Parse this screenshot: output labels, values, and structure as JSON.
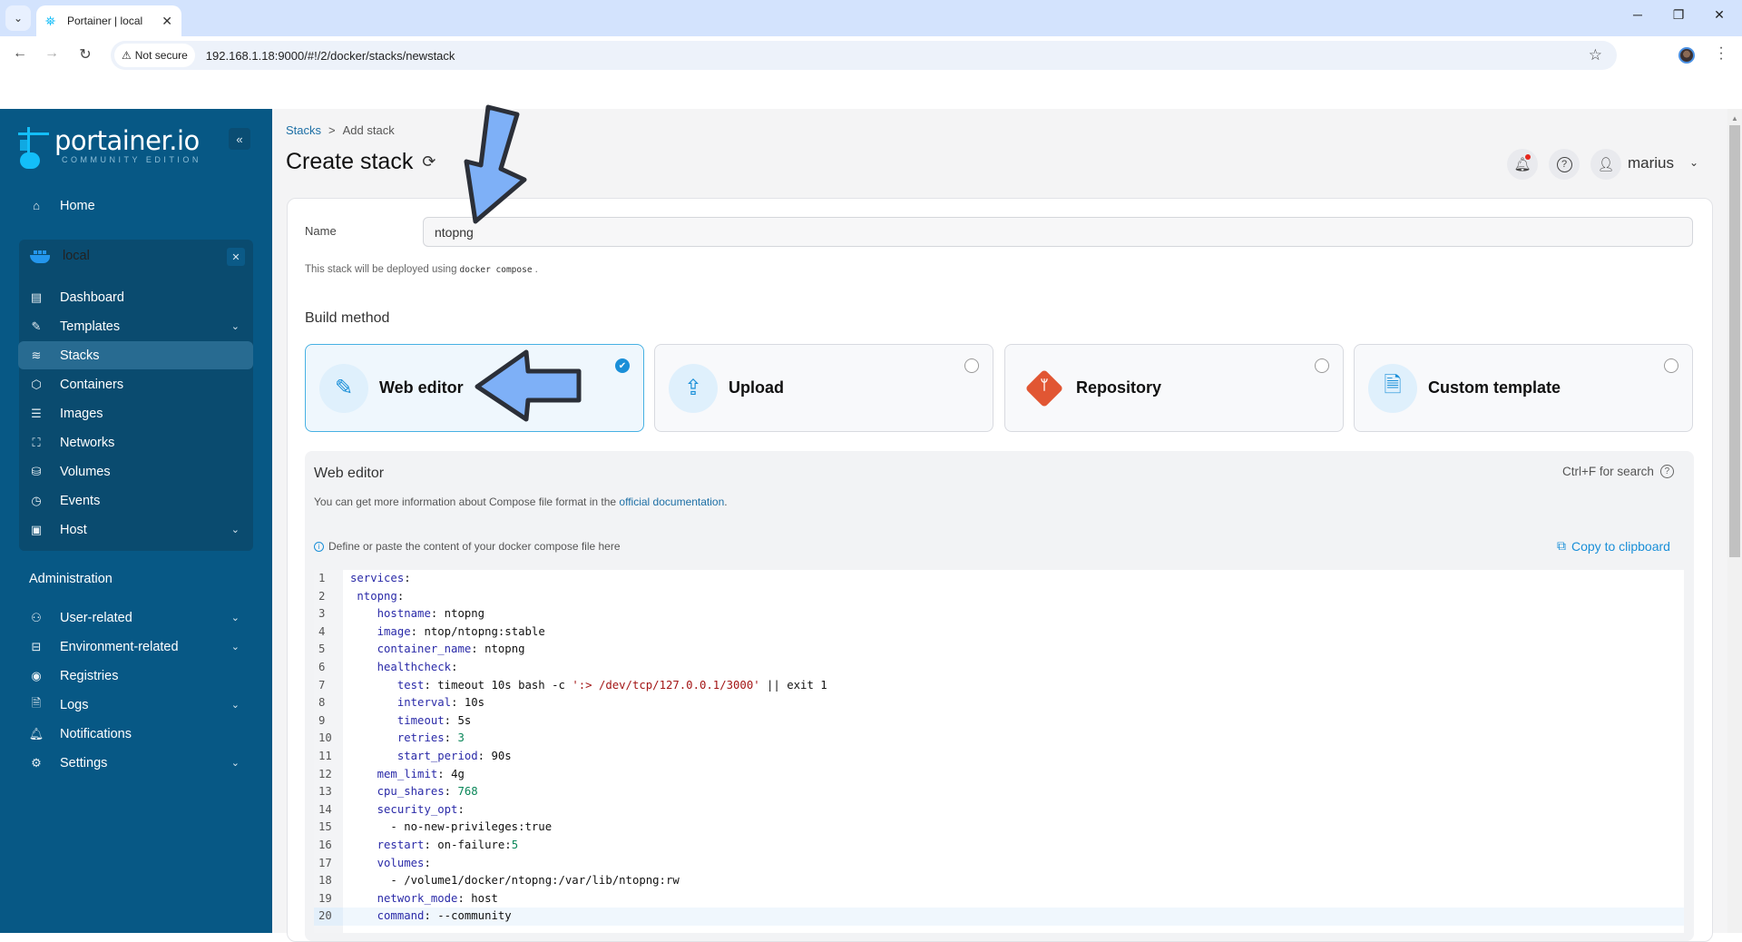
{
  "browser": {
    "tab_title": "Portainer | local",
    "security_label": "Not secure",
    "url": "192.168.1.18:9000/#!/2/docker/stacks/newstack"
  },
  "sidebar": {
    "logo_title": "portainer.io",
    "logo_subtitle": "COMMUNITY EDITION",
    "home_label": "Home",
    "environment_name": "local",
    "env_items": [
      {
        "label": "Dashboard",
        "icon": "dashboard-icon",
        "expandable": false
      },
      {
        "label": "Templates",
        "icon": "edit-icon",
        "expandable": true
      },
      {
        "label": "Stacks",
        "icon": "layers-icon",
        "expandable": false,
        "active": true
      },
      {
        "label": "Containers",
        "icon": "box-icon",
        "expandable": false
      },
      {
        "label": "Images",
        "icon": "list-icon",
        "expandable": false
      },
      {
        "label": "Networks",
        "icon": "network-icon",
        "expandable": false
      },
      {
        "label": "Volumes",
        "icon": "database-icon",
        "expandable": false
      },
      {
        "label": "Events",
        "icon": "clock-icon",
        "expandable": false
      },
      {
        "label": "Host",
        "icon": "host-icon",
        "expandable": true
      }
    ],
    "admin_label": "Administration",
    "admin_items": [
      {
        "label": "User-related",
        "icon": "users-icon",
        "expandable": true
      },
      {
        "label": "Environment-related",
        "icon": "hard-drive-icon",
        "expandable": true
      },
      {
        "label": "Registries",
        "icon": "radio-icon",
        "expandable": false
      },
      {
        "label": "Logs",
        "icon": "file-text-icon",
        "expandable": true
      },
      {
        "label": "Notifications",
        "icon": "bell-icon",
        "expandable": false
      },
      {
        "label": "Settings",
        "icon": "settings-icon",
        "expandable": true
      }
    ]
  },
  "header": {
    "breadcrumb_root": "Stacks",
    "breadcrumb_sep": ">",
    "breadcrumb_current": "Add stack",
    "title": "Create stack",
    "username": "marius"
  },
  "form": {
    "name_label": "Name",
    "name_value": "ntopng",
    "deploy_note_prefix": "This stack will be deployed using",
    "deploy_note_code": "docker compose",
    "deploy_note_suffix": ".",
    "build_method_title": "Build method",
    "build_methods": [
      {
        "label": "Web editor",
        "icon": "edit-icon",
        "selected": true
      },
      {
        "label": "Upload",
        "icon": "upload-cloud-icon",
        "selected": false
      },
      {
        "label": "Repository",
        "icon": "git-icon",
        "selected": false
      },
      {
        "label": "Custom template",
        "icon": "file-text-icon",
        "selected": false
      }
    ]
  },
  "editor": {
    "title": "Web editor",
    "search_hint": "Ctrl+F for search",
    "info_prefix": "You can get more information about Compose file format in the",
    "info_link": "official documentation",
    "info_suffix": ".",
    "define_hint": "Define or paste the content of your docker compose file here",
    "copy_label": "Copy to clipboard",
    "current_line": 20,
    "lines": [
      "services:",
      " ntopng:",
      "    hostname: ntopng",
      "    image: ntop/ntopng:stable",
      "    container_name: ntopng",
      "    healthcheck:",
      "       test: timeout 10s bash -c ':> /dev/tcp/127.0.0.1/3000' || exit 1",
      "       interval: 10s",
      "       timeout: 5s",
      "       retries: 3",
      "       start_period: 90s",
      "    mem_limit: 4g",
      "    cpu_shares: 768",
      "    security_opt:",
      "      - no-new-privileges:true",
      "    restart: on-failure:5",
      "    volumes:",
      "      - /volume1/docker/ntopng:/var/lib/ntopng:rw",
      "    network_mode: host",
      "    command: --community"
    ]
  },
  "colors": {
    "sidebar_bg": "#075885",
    "accent": "#1a8fd8",
    "annotation_arrow": "#7eb0f7"
  }
}
